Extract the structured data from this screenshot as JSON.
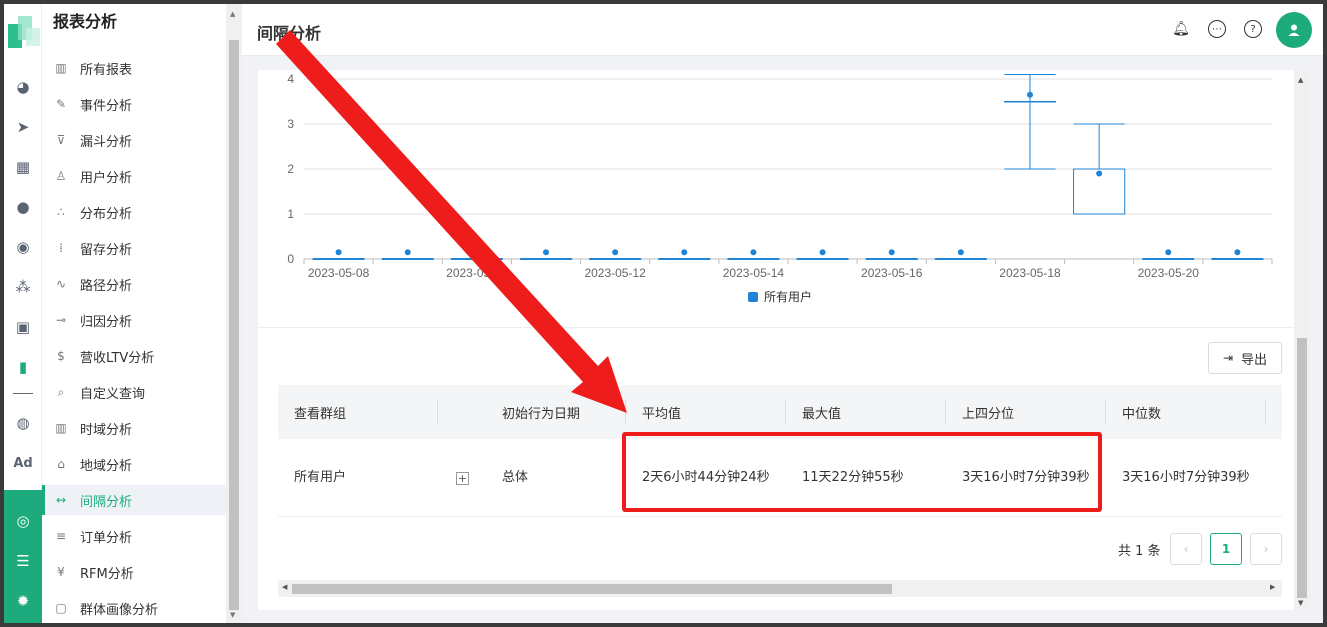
{
  "sidebar": {
    "title": "报表分析",
    "items": [
      {
        "label": "所有报表",
        "icon": "bar-chart-icon"
      },
      {
        "label": "事件分析",
        "icon": "event-icon"
      },
      {
        "label": "漏斗分析",
        "icon": "funnel-icon"
      },
      {
        "label": "用户分析",
        "icon": "user-icon"
      },
      {
        "label": "分布分析",
        "icon": "distribution-icon"
      },
      {
        "label": "留存分析",
        "icon": "retention-icon"
      },
      {
        "label": "路径分析",
        "icon": "path-icon"
      },
      {
        "label": "归因分析",
        "icon": "attribution-icon"
      },
      {
        "label": "营收LTV分析",
        "icon": "revenue-icon"
      },
      {
        "label": "自定义查询",
        "icon": "query-icon"
      },
      {
        "label": "时域分析",
        "icon": "time-chart-icon"
      },
      {
        "label": "地域分析",
        "icon": "location-icon"
      },
      {
        "label": "间隔分析",
        "icon": "interval-icon",
        "active": true
      },
      {
        "label": "订单分析",
        "icon": "order-icon"
      },
      {
        "label": "RFM分析",
        "icon": "rfm-icon"
      },
      {
        "label": "群体画像分析",
        "icon": "portrait-icon"
      }
    ]
  },
  "rail": {
    "icons": [
      "dashboard-icon",
      "send-icon",
      "layout-icon",
      "person-icon",
      "people-icon",
      "cluster-icon",
      "badge-icon",
      "analytics-icon",
      "wechat-icon",
      "ad-icon",
      "team-icon",
      "server-icon",
      "settings-icon"
    ],
    "ad_label": "Ad"
  },
  "header": {
    "title": "间隔分析",
    "icons": [
      "bell-icon",
      "message-icon",
      "help-icon",
      "avatar-icon"
    ]
  },
  "chart_data": {
    "type": "boxplot",
    "ylim": [
      0,
      4
    ],
    "y_ticks": [
      0,
      1,
      2,
      3,
      4
    ],
    "x_tick_labels": [
      "2023-05-08",
      "2023-05-10",
      "2023-05-12",
      "2023-05-14",
      "2023-05-16",
      "2023-05-18",
      "2023-05-20"
    ],
    "legend": [
      "所有用户"
    ],
    "legend_position": "bottom-center",
    "series_color": "#1f84d6",
    "dates": [
      "2023-05-08",
      "2023-05-09",
      "2023-05-10",
      "2023-05-11",
      "2023-05-12",
      "2023-05-13",
      "2023-05-14",
      "2023-05-15",
      "2023-05-16",
      "2023-05-17",
      "2023-05-18",
      "2023-05-19",
      "2023-05-20",
      "2023-05-21"
    ],
    "boxes": [
      {
        "min": 0,
        "q1": 0,
        "median": 0,
        "q3": 0,
        "max": 0,
        "mean": 0.15
      },
      {
        "min": 0,
        "q1": 0,
        "median": 0,
        "q3": 0,
        "max": 0,
        "mean": 0.15
      },
      {
        "min": 0,
        "q1": 0,
        "median": 0,
        "q3": 0,
        "max": 0,
        "mean": 0.15
      },
      {
        "min": 0,
        "q1": 0,
        "median": 0,
        "q3": 0,
        "max": 0,
        "mean": 0.15
      },
      {
        "min": 0,
        "q1": 0,
        "median": 0,
        "q3": 0,
        "max": 0,
        "mean": 0.15
      },
      {
        "min": 0,
        "q1": 0,
        "median": 0,
        "q3": 0,
        "max": 0,
        "mean": 0.15
      },
      {
        "min": 0,
        "q1": 0,
        "median": 0,
        "q3": 0,
        "max": 0,
        "mean": 0.15
      },
      {
        "min": 0,
        "q1": 0,
        "median": 0,
        "q3": 0,
        "max": 0,
        "mean": 0.15
      },
      {
        "min": 0,
        "q1": 0,
        "median": 0,
        "q3": 0,
        "max": 0,
        "mean": 0.15
      },
      {
        "min": 0,
        "q1": 0,
        "median": 0,
        "q3": 0,
        "max": 0,
        "mean": 0.15
      },
      {
        "min": 2,
        "q1": 3.5,
        "median": 3.5,
        "q3": 3.5,
        "max": 4.1,
        "mean": 3.65
      },
      {
        "min": 1,
        "q1": 1,
        "median": 2,
        "q3": 2,
        "max": 3,
        "mean": 1.9
      },
      {
        "min": 0,
        "q1": 0,
        "median": 0,
        "q3": 0,
        "max": 0,
        "mean": 0.15
      },
      {
        "min": 0,
        "q1": 0,
        "median": 0,
        "q3": 0,
        "max": 0,
        "mean": 0.15
      }
    ]
  },
  "toolbar": {
    "export_label": "导出"
  },
  "table": {
    "headers": [
      "查看群组",
      "初始行为日期",
      "平均值",
      "最大值",
      "上四分位",
      "中位数"
    ],
    "row": {
      "group": "所有用户",
      "date": "总体",
      "avg": "2天6小时44分钟24秒",
      "max": "11天22分钟55秒",
      "q3": "3天16小时7分钟39秒",
      "median": "3天16小时7分钟39秒"
    }
  },
  "pagination": {
    "total": "共 1 条",
    "current": "1"
  },
  "colors": {
    "accent": "#1dab7d",
    "annotation": "#ef1c1c",
    "series": "#1f84d6"
  }
}
